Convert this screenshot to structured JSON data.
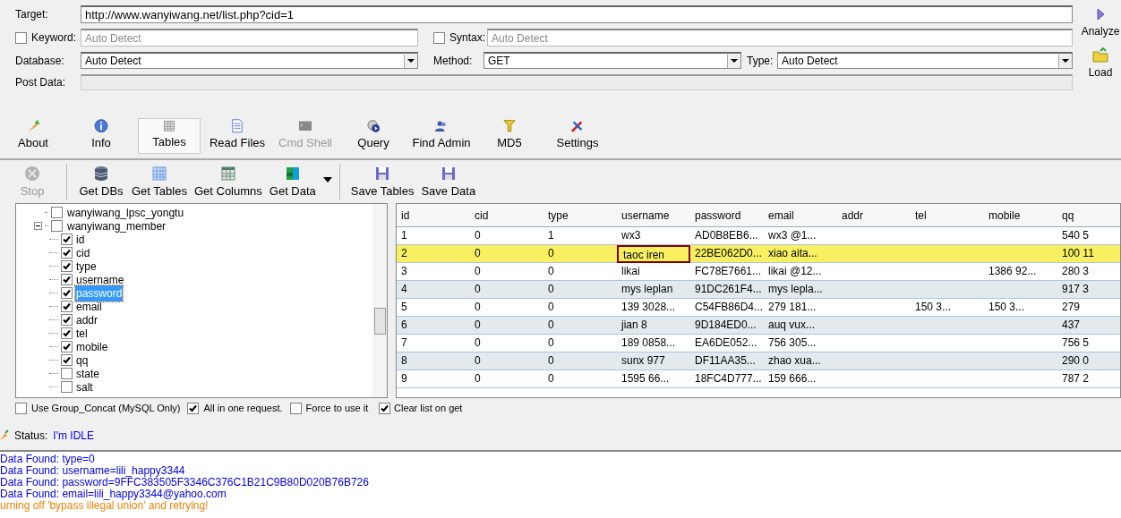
{
  "form": {
    "target_label": "Target:",
    "target_value": "http://www.wanyiwang.net/list.php?cid=1",
    "keyword": {
      "label": "Keyword:",
      "checked": false,
      "placeholder": "Auto Detect"
    },
    "syntax": {
      "label": "Syntax:",
      "checked": false,
      "placeholder": "Auto Detect"
    },
    "database": {
      "label": "Database:",
      "value": "Auto Detect"
    },
    "method": {
      "label": "Method:",
      "value": "GET"
    },
    "type": {
      "label": "Type:",
      "value": "Auto Detect"
    },
    "post_label": "Post Data:",
    "side_buttons": [
      {
        "label": "Analyze",
        "kind": "play"
      },
      {
        "label": "Load",
        "kind": "folder"
      }
    ]
  },
  "tabs": [
    {
      "label": "About",
      "selected": false,
      "disabled": false
    },
    {
      "label": "Info",
      "selected": false,
      "disabled": false
    },
    {
      "label": "Tables",
      "selected": true,
      "disabled": false
    },
    {
      "label": "Read Files",
      "selected": false,
      "disabled": false
    },
    {
      "label": "Cmd Shell",
      "selected": false,
      "disabled": true
    },
    {
      "label": "Query",
      "selected": false,
      "disabled": false
    },
    {
      "label": "Find Admin",
      "selected": false,
      "disabled": false
    },
    {
      "label": "MD5",
      "selected": false,
      "disabled": false
    },
    {
      "label": "Settings",
      "selected": false,
      "disabled": false
    }
  ],
  "actions": [
    {
      "label": "Stop",
      "disabled": true
    },
    {
      "label": "Get DBs",
      "disabled": false
    },
    {
      "label": "Get Tables",
      "disabled": false
    },
    {
      "label": "Get Columns",
      "disabled": false
    },
    {
      "label": "Get Data",
      "disabled": false
    },
    {
      "label": "Save Tables",
      "disabled": false
    },
    {
      "label": "Save Data",
      "disabled": false
    }
  ],
  "tree": [
    {
      "label": "wanyiwang_lpsc_yongtu",
      "checked": false
    },
    {
      "label": "wanyiwang_member",
      "checked": false,
      "expanded": true,
      "children": [
        {
          "label": "id",
          "checked": true,
          "selected": false
        },
        {
          "label": "cid",
          "checked": true,
          "selected": false
        },
        {
          "label": "type",
          "checked": true,
          "selected": false
        },
        {
          "label": "username",
          "checked": true,
          "selected": false
        },
        {
          "label": "password",
          "checked": true,
          "selected": true
        },
        {
          "label": "email",
          "checked": true,
          "selected": false
        },
        {
          "label": "addr",
          "checked": true,
          "selected": false
        },
        {
          "label": "tel",
          "checked": true,
          "selected": false
        },
        {
          "label": "mobile",
          "checked": true,
          "selected": false
        },
        {
          "label": "qq",
          "checked": true,
          "selected": false
        },
        {
          "label": "state",
          "checked": false,
          "selected": false
        },
        {
          "label": "salt",
          "checked": false,
          "selected": false
        }
      ]
    }
  ],
  "options": [
    {
      "label": "Use Group_Concat (MySQL Only)",
      "checked": false
    },
    {
      "label": "All in one request.",
      "checked": true
    },
    {
      "label": "Force to use it",
      "checked": false
    },
    {
      "label": "Clear list on get",
      "checked": true
    }
  ],
  "table": {
    "columns": [
      "id",
      "cid",
      "type",
      "username",
      "password",
      "email",
      "addr",
      "tel",
      "mobile",
      "qq"
    ],
    "rows": [
      {
        "selected": false,
        "cells": [
          "1",
          "0",
          "1",
          "wx3",
          "AD0B8EB6...",
          "wx3 @1...",
          "",
          "",
          "",
          "540 5"
        ]
      },
      {
        "selected": true,
        "cells": [
          "2",
          "0",
          "0",
          "taoc iren",
          "22BE062D0...",
          "xiao aita...",
          "",
          "",
          "",
          "100 11"
        ]
      },
      {
        "selected": false,
        "cells": [
          "3",
          "0",
          "0",
          "likai",
          "FC78E7661...",
          "likai @12...",
          "",
          "",
          "1386 92...",
          "280 3"
        ]
      },
      {
        "selected": false,
        "cells": [
          "4",
          "0",
          "0",
          "mys leplan",
          "91DC261F4...",
          "mys lepla...",
          "",
          "",
          "",
          "917 3"
        ]
      },
      {
        "selected": false,
        "cells": [
          "5",
          "0",
          "0",
          "139 3028...",
          "C54FB86D4...",
          "279 181...",
          "",
          "150 3...",
          "150 3...",
          "279"
        ]
      },
      {
        "selected": false,
        "cells": [
          "6",
          "0",
          "0",
          "jian 8",
          "9D184ED0...",
          "auq vux...",
          "",
          "",
          "",
          "437"
        ]
      },
      {
        "selected": false,
        "cells": [
          "7",
          "0",
          "0",
          "189 0858...",
          "EA6DE052...",
          "756 305...",
          "",
          "",
          "",
          "756 5"
        ]
      },
      {
        "selected": false,
        "cells": [
          "8",
          "0",
          "0",
          "sunx 977",
          "DF11AA35...",
          "zhao xua...",
          "",
          "",
          "",
          "290 0"
        ]
      },
      {
        "selected": false,
        "cells": [
          "9",
          "0",
          "0",
          "1595 66...",
          "18FC4D777...",
          "159 666...",
          "",
          "",
          "",
          "787 2"
        ]
      }
    ]
  },
  "status": {
    "label": "Status:",
    "value": "I'm IDLE"
  },
  "log": [
    {
      "text": "Data Found: type=0",
      "kind": "found"
    },
    {
      "text": "Data Found: username=lili_happy3344",
      "kind": "found"
    },
    {
      "text": "Data Found: password=9FFC383505F3346C376C1B21C9B80D020B76B726",
      "kind": "found"
    },
    {
      "text": "Data Found: email=lili_happy3344@yahoo.com",
      "kind": "found"
    },
    {
      "text": "urning off 'bypass illegal union' and retrying!",
      "kind": "warning"
    }
  ]
}
